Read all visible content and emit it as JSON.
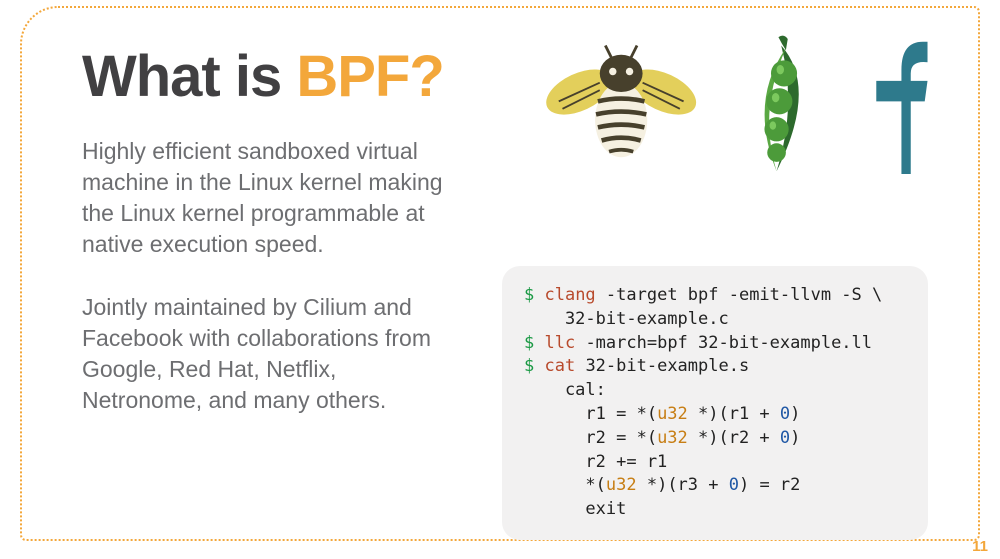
{
  "title_plain": "What is ",
  "title_accent": "BPF?",
  "para1": "Highly efficient sandboxed virtual machine in the Linux kernel making the Linux kernel programmable at native execution speed.",
  "para2": "Jointly maintained by Cilium and Facebook with collaborations from Google, Red Hat, Netflix, Netronome, and many others.",
  "code": {
    "l1a": "$",
    "l1b": " clang",
    "l1c": " -target bpf -emit-llvm -S \\",
    "l2": "    32-bit-example.c",
    "l3a": "$",
    "l3b": " llc",
    "l3c": " -march=bpf 32-bit-example.ll",
    "l4a": "$",
    "l4b": " cat",
    "l4c": " 32-bit-example.s",
    "l5": "    cal:",
    "l6a": "      r1 = *(",
    "l6b": "u32",
    "l6c": " *)(r1 + ",
    "l6d": "0",
    "l6e": ")",
    "l7a": "      r2 = *(",
    "l7b": "u32",
    "l7c": " *)(r2 + ",
    "l7d": "0",
    "l7e": ")",
    "l8": "      r2 += r1",
    "l9a": "      *(",
    "l9b": "u32",
    "l9c": " *)(r3 + ",
    "l9d": "0",
    "l9e": ") = r2",
    "l10": "      exit"
  },
  "page_number": "11"
}
